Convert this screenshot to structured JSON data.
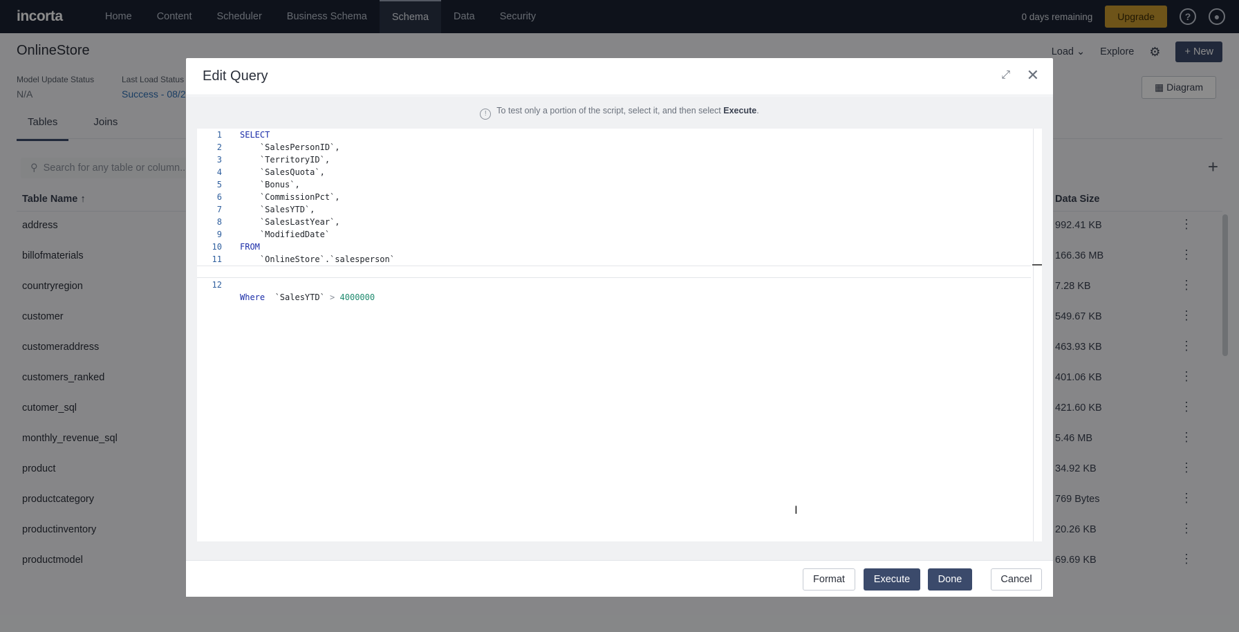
{
  "app": {
    "logo": "incorta",
    "nav": [
      "Home",
      "Content",
      "Scheduler",
      "Business Schema",
      "Schema",
      "Data",
      "Security"
    ],
    "active_nav": "Schema",
    "days_remaining": "0 days remaining",
    "upgrade_label": "Upgrade"
  },
  "page": {
    "title": "OnlineStore",
    "load_label": "Load",
    "explore_label": "Explore",
    "new_label": "New",
    "model_update_status_label": "Model Update Status",
    "model_update_status_value": "N/A",
    "last_load_status_label": "Last Load Status",
    "last_load_status_value": "Success - 08/2",
    "diagram_label": "Diagram",
    "tabs": [
      "Tables",
      "Joins"
    ],
    "search_placeholder": "Search for any table or column...",
    "col_table_name": "Table Name",
    "col_data_size": "Data Size",
    "rows": [
      {
        "name": "address",
        "size": "992.41 KB"
      },
      {
        "name": "billofmaterials",
        "size": "166.36 MB"
      },
      {
        "name": "countryregion",
        "size": "7.28 KB"
      },
      {
        "name": "customer",
        "size": "549.67 KB"
      },
      {
        "name": "customeraddress",
        "size": "463.93 KB"
      },
      {
        "name": "customers_ranked",
        "size": "401.06 KB"
      },
      {
        "name": "cutomer_sql",
        "size": "421.60 KB"
      },
      {
        "name": "monthly_revenue_sql",
        "size": "5.46 MB"
      },
      {
        "name": "product",
        "size": "34.92 KB"
      },
      {
        "name": "productcategory",
        "size": "769 Bytes"
      },
      {
        "name": "productinventory",
        "size": "20.26 KB"
      },
      {
        "name": "productmodel",
        "size": "69.69 KB"
      }
    ]
  },
  "modal": {
    "title": "Edit Query",
    "hint_text": "To test only a portion of the script, select it, and then select ",
    "hint_bold": "Execute",
    "hint_end": ".",
    "code_lines": [
      {
        "n": "1",
        "kw": "SELECT",
        "rest": ""
      },
      {
        "n": "2",
        "kw": "",
        "rest": "    `SalesPersonID`,"
      },
      {
        "n": "3",
        "kw": "",
        "rest": "    `TerritoryID`,"
      },
      {
        "n": "4",
        "kw": "",
        "rest": "    `SalesQuota`,"
      },
      {
        "n": "5",
        "kw": "",
        "rest": "    `Bonus`,"
      },
      {
        "n": "6",
        "kw": "",
        "rest": "    `CommissionPct`,"
      },
      {
        "n": "7",
        "kw": "",
        "rest": "    `SalesYTD`,"
      },
      {
        "n": "8",
        "kw": "",
        "rest": "    `SalesLastYear`,"
      },
      {
        "n": "9",
        "kw": "",
        "rest": "    `ModifiedDate`"
      },
      {
        "n": "10",
        "kw": "FROM",
        "rest": ""
      },
      {
        "n": "11",
        "kw": "",
        "rest": "    `OnlineStore`.`salesperson`"
      }
    ],
    "last_line": {
      "n": "12",
      "kw": "Where",
      "col": "  `SalesYTD`",
      "op": " > ",
      "num": "4000000"
    },
    "format_label": "Format",
    "execute_label": "Execute",
    "done_label": "Done",
    "cancel_label": "Cancel"
  }
}
